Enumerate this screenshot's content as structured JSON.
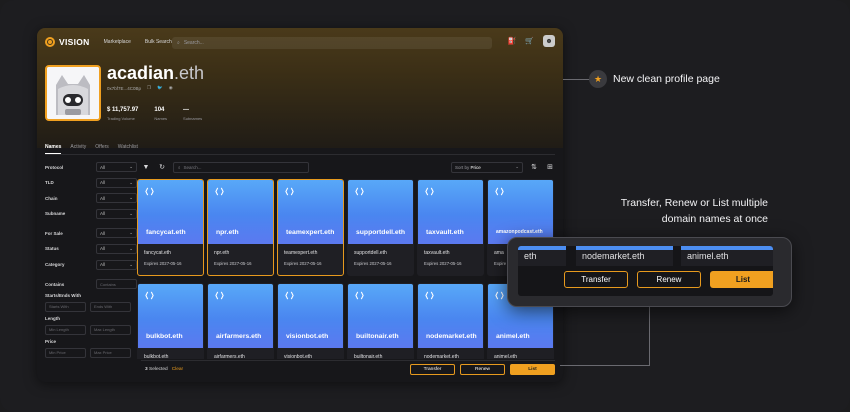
{
  "nav": {
    "brand": "VISION",
    "links": [
      "Marketplace",
      "Bulk Search"
    ],
    "search_placeholder": "Search..."
  },
  "profile": {
    "name": "acadian",
    "tld": ".eth",
    "address": "0x7bf7E...4C0Bp",
    "stats": [
      {
        "value": "$ 11,757.97",
        "label": "Trading Volume"
      },
      {
        "value": "104",
        "label": "Names"
      },
      {
        "value": "—",
        "label": "Subnames"
      }
    ]
  },
  "tabs": [
    "Names",
    "Activity",
    "Offers",
    "Watchlist"
  ],
  "filters": {
    "selects": [
      {
        "label": "Protocol",
        "value": "All"
      },
      {
        "label": "TLD",
        "value": "All"
      },
      {
        "label": "Chain",
        "value": "All"
      },
      {
        "label": "Subname",
        "value": "All"
      },
      {
        "label": "For Sale",
        "value": "All"
      },
      {
        "label": "Status",
        "value": "All"
      },
      {
        "label": "Category",
        "value": "All"
      }
    ],
    "contains_label": "Contains",
    "contains_placeholder": "Contains",
    "starts_label": "Starts/Ends With",
    "starts_placeholder": "Starts With",
    "ends_placeholder": "Ends With",
    "length_label": "Length",
    "min_length": "Min Length",
    "max_length": "Max Length",
    "price_label": "Price",
    "min_price": "Min Price",
    "max_price": "Max Price"
  },
  "toolbar": {
    "search_placeholder": "Search...",
    "sort_prefix": "Sort by",
    "sort_value": "Price"
  },
  "cards_row1": [
    {
      "domain": "fancycat.eth",
      "name": "fancycat.eth",
      "expires": "Expires 2027-05-16",
      "selected": true
    },
    {
      "domain": "npr.eth",
      "name": "npr.eth",
      "expires": "Expires 2027-05-16",
      "selected": true
    },
    {
      "domain": "teamexpert.eth",
      "name": "teamexpert.eth",
      "expires": "Expires 2027-05-16",
      "selected": true
    },
    {
      "domain": "supportdell.eth",
      "name": "supportdell.eth",
      "expires": "Expires 2027-05-16",
      "selected": false
    },
    {
      "domain": "taxvault.eth",
      "name": "taxvault.eth",
      "expires": "Expires 2027-05-16",
      "selected": false
    },
    {
      "domain": "amazonpodcast.eth",
      "name": "ama",
      "expires": "Expire",
      "selected": false
    }
  ],
  "cards_row2": [
    {
      "domain": "bulkbot.eth",
      "name": "bulkbot.eth"
    },
    {
      "domain": "airfarmers.eth",
      "name": "airfarmers.eth"
    },
    {
      "domain": "visionbot.eth",
      "name": "visionbot.eth"
    },
    {
      "domain": "builtonair.eth",
      "name": "builtonair.eth"
    },
    {
      "domain": "nodemarket.eth",
      "name": "nodemarket.eth"
    },
    {
      "domain": "animel.eth",
      "name": "animel.eth"
    }
  ],
  "bottom": {
    "count": "3",
    "selected_label": "Selected",
    "clear": "Clear",
    "transfer": "Transfer",
    "renew": "Renew",
    "list": "List"
  },
  "callouts": {
    "profile": "New clean profile page",
    "bulk_line1": "Transfer, Renew or List multiple",
    "bulk_line2": "domain names at once"
  },
  "zoom": {
    "names": [
      "eth",
      "nodemarket.eth",
      "animel.eth"
    ],
    "transfer": "Transfer",
    "renew": "Renew",
    "list": "List"
  },
  "colors": {
    "accent": "#f0a020",
    "card_blue": "#4a86f0"
  }
}
